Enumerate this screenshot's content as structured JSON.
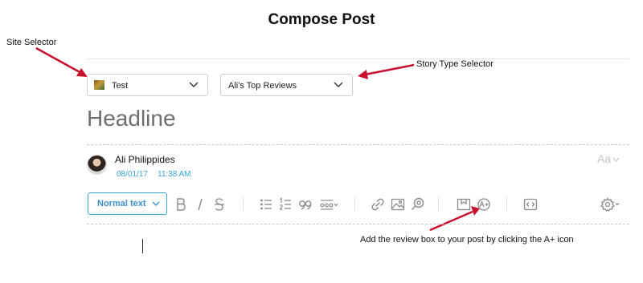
{
  "page": {
    "title": "Compose Post"
  },
  "annotations": {
    "site_selector": "Site Selector",
    "story_type_selector": "Story Type Selector",
    "review_box": "Add the review box to your post by clicking the A+ icon"
  },
  "site_select": {
    "value": "Test",
    "icon": "site-thumbnail"
  },
  "story_type_select": {
    "value": "Ali's Top Reviews"
  },
  "editor": {
    "headline_placeholder": "Headline",
    "author_name": "Ali Philippides",
    "date": "08/01/17",
    "time": "11:38 AM",
    "font_size_toggle": "Aa"
  },
  "toolbar": {
    "paragraph_style": "Normal text",
    "tools": [
      "bold-icon",
      "italic-icon",
      "strikethrough-icon",
      "bullet-list-icon",
      "numbered-list-icon",
      "quote-icon",
      "more-format-icon",
      "link-icon",
      "image-icon",
      "search-media-icon",
      "gallery-icon",
      "review-box-a-plus-icon",
      "embed-code-icon",
      "settings-gear-icon"
    ]
  },
  "colors": {
    "accent": "#3aa4d8",
    "arrow": "#c8102e",
    "icon_gray": "#8a8a8a"
  }
}
